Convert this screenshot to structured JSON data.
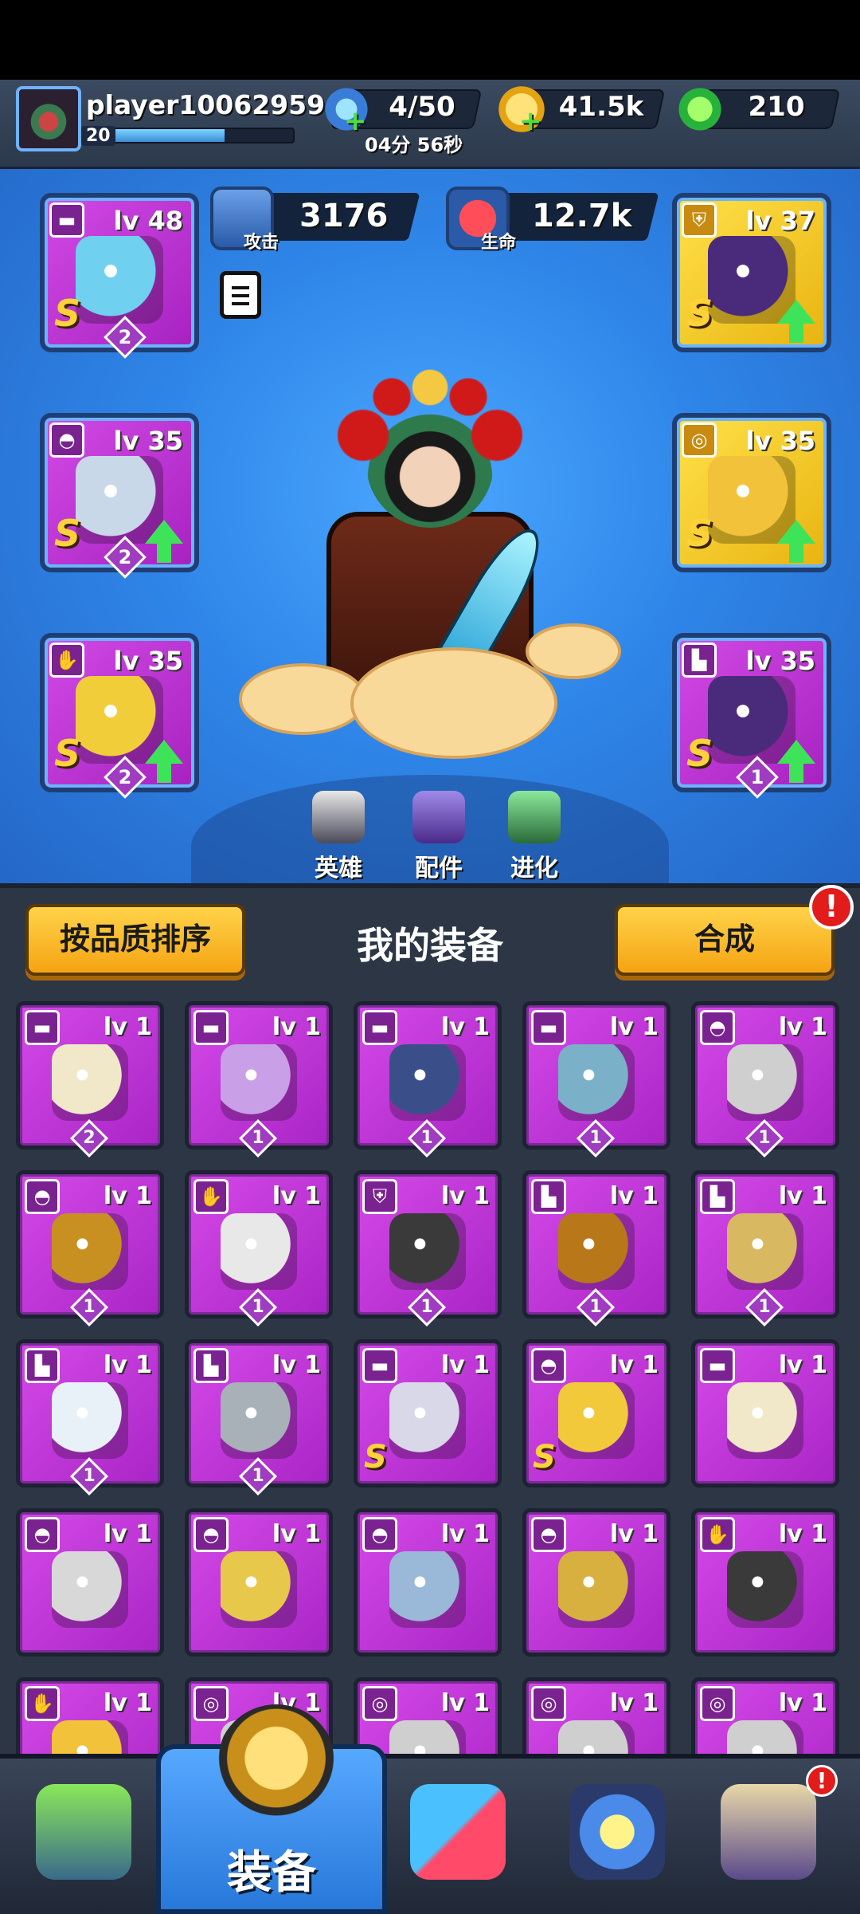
{
  "player": {
    "name": "player10062959",
    "level": "20",
    "xp_fraction": 0.62
  },
  "resources": {
    "energy": {
      "value": "4/50",
      "timer": "04分 56秒"
    },
    "coins": {
      "value": "41.5k"
    },
    "gems": {
      "value": "210"
    }
  },
  "hero": {
    "attack": {
      "label": "攻击",
      "value": "3176"
    },
    "health": {
      "label": "生命",
      "value": "12.7k"
    },
    "tabs": [
      {
        "label": "英雄",
        "icon": "hero-helmet-icon"
      },
      {
        "label": "配件",
        "icon": "accessory-icon"
      },
      {
        "label": "进化",
        "icon": "evolution-dna-icon"
      }
    ],
    "equipped": [
      {
        "slot": "weapon",
        "type_icon": "gun-icon",
        "lv": "lv 48",
        "rank": "S",
        "count": "2",
        "rarity": "purple",
        "upgrade": false,
        "art_color": "#6fd0f0"
      },
      {
        "slot": "helmet",
        "type_icon": "helmet-icon",
        "lv": "lv 35",
        "rank": "S",
        "count": "2",
        "rarity": "purple",
        "upgrade": true,
        "art_color": "#c8d8e8"
      },
      {
        "slot": "gloves",
        "type_icon": "glove-icon",
        "lv": "lv 35",
        "rank": "S",
        "count": "2",
        "rarity": "purple",
        "upgrade": true,
        "art_color": "#f2cd3a"
      },
      {
        "slot": "armor",
        "type_icon": "armor-icon",
        "lv": "lv 37",
        "rank": "S",
        "count": "",
        "rarity": "gold",
        "upgrade": true,
        "art_color": "#4a2a7a"
      },
      {
        "slot": "ring",
        "type_icon": "ring-icon",
        "lv": "lv 35",
        "rank": "S",
        "count": "",
        "rarity": "gold",
        "upgrade": true,
        "art_color": "#f2c23a"
      },
      {
        "slot": "boots",
        "type_icon": "boot-icon",
        "lv": "lv 35",
        "rank": "S",
        "count": "1",
        "rarity": "purple",
        "upgrade": true,
        "art_color": "#4a2a7a"
      }
    ]
  },
  "inventory": {
    "sort_label": "按品质排序",
    "title": "我的装备",
    "merge_label": "合成",
    "alert": "!",
    "items": [
      {
        "type_icon": "gun-icon",
        "lv": "lv 1",
        "count": "2",
        "rank": "",
        "art_color": "#f0e8c8"
      },
      {
        "type_icon": "gun-icon",
        "lv": "lv 1",
        "count": "1",
        "rank": "",
        "art_color": "#c9a0e8"
      },
      {
        "type_icon": "gun-icon",
        "lv": "lv 1",
        "count": "1",
        "rank": "",
        "art_color": "#3a4f8a"
      },
      {
        "type_icon": "gun-icon",
        "lv": "lv 1",
        "count": "1",
        "rank": "",
        "art_color": "#7ab0c8"
      },
      {
        "type_icon": "helmet-icon",
        "lv": "lv 1",
        "count": "1",
        "rank": "",
        "art_color": "#cfcfcf"
      },
      {
        "type_icon": "helmet-icon",
        "lv": "lv 1",
        "count": "1",
        "rank": "",
        "art_color": "#c89020"
      },
      {
        "type_icon": "glove-icon",
        "lv": "lv 1",
        "count": "1",
        "rank": "",
        "art_color": "#e8e8e8"
      },
      {
        "type_icon": "armor-icon",
        "lv": "lv 1",
        "count": "1",
        "rank": "",
        "art_color": "#3a3a3a"
      },
      {
        "type_icon": "boot-icon",
        "lv": "lv 1",
        "count": "1",
        "rank": "",
        "art_color": "#b8781a"
      },
      {
        "type_icon": "boot-icon",
        "lv": "lv 1",
        "count": "1",
        "rank": "",
        "art_color": "#d8b860"
      },
      {
        "type_icon": "boot-icon",
        "lv": "lv 1",
        "count": "1",
        "rank": "",
        "art_color": "#e8f0f8"
      },
      {
        "type_icon": "boot-icon",
        "lv": "lv 1",
        "count": "1",
        "rank": "",
        "art_color": "#a8b0b8"
      },
      {
        "type_icon": "gun-icon",
        "lv": "lv 1",
        "count": "",
        "rank": "S",
        "art_color": "#d8d8e8"
      },
      {
        "type_icon": "helmet-icon",
        "lv": "lv 1",
        "count": "",
        "rank": "S",
        "art_color": "#f2c93a"
      },
      {
        "type_icon": "gun-icon",
        "lv": "lv 1",
        "count": "",
        "rank": "",
        "art_color": "#f0e8c8"
      },
      {
        "type_icon": "helmet-icon",
        "lv": "lv 1",
        "count": "",
        "rank": "",
        "art_color": "#d8d8d8"
      },
      {
        "type_icon": "helmet-icon",
        "lv": "lv 1",
        "count": "",
        "rank": "",
        "art_color": "#e8c84a"
      },
      {
        "type_icon": "helmet-icon",
        "lv": "lv 1",
        "count": "",
        "rank": "",
        "art_color": "#9ab8d8"
      },
      {
        "type_icon": "helmet-icon",
        "lv": "lv 1",
        "count": "",
        "rank": "",
        "art_color": "#d8b040"
      },
      {
        "type_icon": "glove-icon",
        "lv": "lv 1",
        "count": "",
        "rank": "",
        "art_color": "#3a3a3a"
      },
      {
        "type_icon": "glove-icon",
        "lv": "lv 1",
        "count": "",
        "rank": "",
        "art_color": "#f2c23a"
      },
      {
        "type_icon": "ring-icon",
        "lv": "lv 1",
        "count": "",
        "rank": "",
        "art_color": "#cfcfcf"
      },
      {
        "type_icon": "ring-icon",
        "lv": "lv 1",
        "count": "",
        "rank": "",
        "art_color": "#cfcfcf"
      },
      {
        "type_icon": "ring-icon",
        "lv": "lv 1",
        "count": "",
        "rank": "",
        "art_color": "#cfcfcf"
      },
      {
        "type_icon": "ring-icon",
        "lv": "lv 1",
        "count": "",
        "rank": "",
        "art_color": "#cfcfcf"
      }
    ]
  },
  "nav": {
    "active_label": "装备",
    "badge": "!",
    "items": [
      {
        "name": "nav-shop",
        "icon": "treasure-chest-icon"
      },
      {
        "name": "nav-equipment",
        "icon": "hero-helmet-icon"
      },
      {
        "name": "nav-battle",
        "icon": "crossed-swords-icon"
      },
      {
        "name": "nav-pet",
        "icon": "drone-icon"
      },
      {
        "name": "nav-rank",
        "icon": "rank-emblem-icon"
      }
    ]
  },
  "colors": {
    "hero_bg": "#2f86e8",
    "item_purple": "#c23adb",
    "item_gold": "#f2c21a",
    "upgrade_green": "#3ee35a",
    "alert_red": "#e21b1b"
  }
}
